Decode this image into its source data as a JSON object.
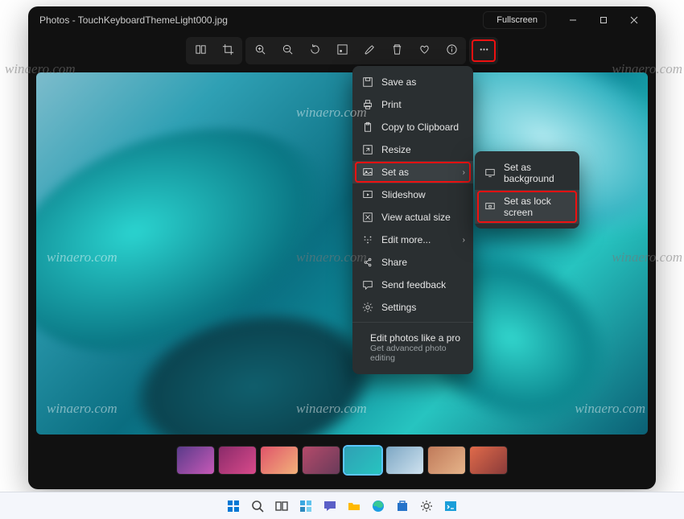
{
  "window": {
    "title": "Photos - TouchKeyboardThemeLight000.jpg",
    "fullscreen_label": "Fullscreen"
  },
  "toolbar": {
    "groups": [
      {
        "items": [
          {
            "name": "compare-icon",
            "title": "Compare"
          },
          {
            "name": "crop-icon",
            "title": "Edit"
          }
        ]
      },
      {
        "items": [
          {
            "name": "zoom-in-icon",
            "title": "Zoom in"
          },
          {
            "name": "zoom-out-icon",
            "title": "Zoom out"
          },
          {
            "name": "rotate-icon",
            "title": "Rotate"
          },
          {
            "name": "adjust-icon",
            "title": "Adjust"
          },
          {
            "name": "draw-icon",
            "title": "Draw"
          },
          {
            "name": "delete-icon",
            "title": "Delete"
          },
          {
            "name": "favorite-icon",
            "title": "Favorite"
          },
          {
            "name": "info-icon",
            "title": "Info"
          }
        ]
      },
      {
        "items": [
          {
            "name": "more-icon",
            "title": "More",
            "highlight": true
          }
        ]
      }
    ]
  },
  "menu": {
    "items": [
      {
        "icon": "save-icon",
        "label": "Save as"
      },
      {
        "icon": "print-icon",
        "label": "Print"
      },
      {
        "icon": "clipboard-icon",
        "label": "Copy to Clipboard"
      },
      {
        "icon": "resize-icon",
        "label": "Resize"
      },
      {
        "icon": "setas-icon",
        "label": "Set as",
        "submenu": true,
        "highlight": true,
        "red": true
      },
      {
        "icon": "slideshow-icon",
        "label": "Slideshow"
      },
      {
        "icon": "actualsize-icon",
        "label": "View actual size"
      },
      {
        "icon": "editmore-icon",
        "label": "Edit more...",
        "submenu": true
      },
      {
        "icon": "share-icon",
        "label": "Share"
      },
      {
        "icon": "feedback-icon",
        "label": "Send feedback"
      },
      {
        "icon": "settings-icon",
        "label": "Settings"
      }
    ],
    "promo": {
      "title": "Edit photos like a pro",
      "subtitle": "Get advanced photo editing"
    },
    "submenu": {
      "items": [
        {
          "icon": "desktop-icon",
          "label": "Set as background"
        },
        {
          "icon": "lock-icon",
          "label": "Set as lock screen",
          "highlight": true,
          "red": true
        }
      ]
    }
  },
  "filmstrip": {
    "count": 8,
    "selected_index": 4,
    "colors": [
      "linear-gradient(135deg,#5a3b8a,#c759b7)",
      "linear-gradient(135deg,#8a2b6a,#d94a8b)",
      "linear-gradient(135deg,#e0546a,#f2b27a)",
      "linear-gradient(135deg,#b44a6a,#6a3b5a)",
      "linear-gradient(135deg,#2fa0b4,#27c4c0)",
      "linear-gradient(135deg,#7da7c4,#cfe2ef)",
      "linear-gradient(135deg,#c07a5a,#e6b48a)",
      "linear-gradient(135deg,#e06a4a,#8a3b3a)"
    ]
  },
  "watermark": "winaero.com",
  "taskbar": {
    "items": [
      "start-icon",
      "search-icon",
      "taskview-icon",
      "widgets-icon",
      "chat-icon",
      "explorer-icon",
      "edge-icon",
      "store-icon",
      "settings-icon",
      "terminal-icon"
    ]
  }
}
